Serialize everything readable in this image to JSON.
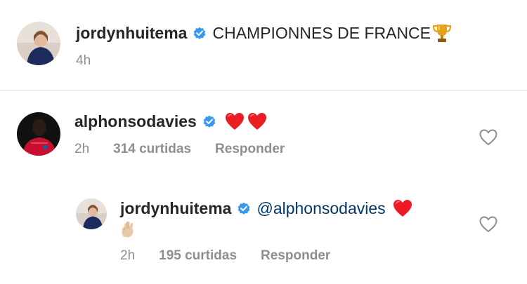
{
  "post": {
    "username": "jordynhuitema",
    "caption": "CHAMPIONNES DE FRANCE",
    "caption_emoji": "trophy-icon",
    "time": "4h"
  },
  "comment": {
    "username": "alphonsodavies",
    "text_emoji": [
      "red-heart-icon",
      "red-heart-icon"
    ],
    "time": "2h",
    "likes": "314 curtidas",
    "reply_label": "Responder"
  },
  "reply": {
    "username": "jordynhuitema",
    "mention": "@alphonsodavies",
    "text_emoji": [
      "red-heart-icon",
      "crossed-fingers-icon"
    ],
    "time": "2h",
    "likes": "195 curtidas",
    "reply_label": "Responder"
  },
  "colors": {
    "verified": "#3897f0",
    "heart": "#ed1c24",
    "mention": "#00376b",
    "meta": "#8e8e8e"
  }
}
